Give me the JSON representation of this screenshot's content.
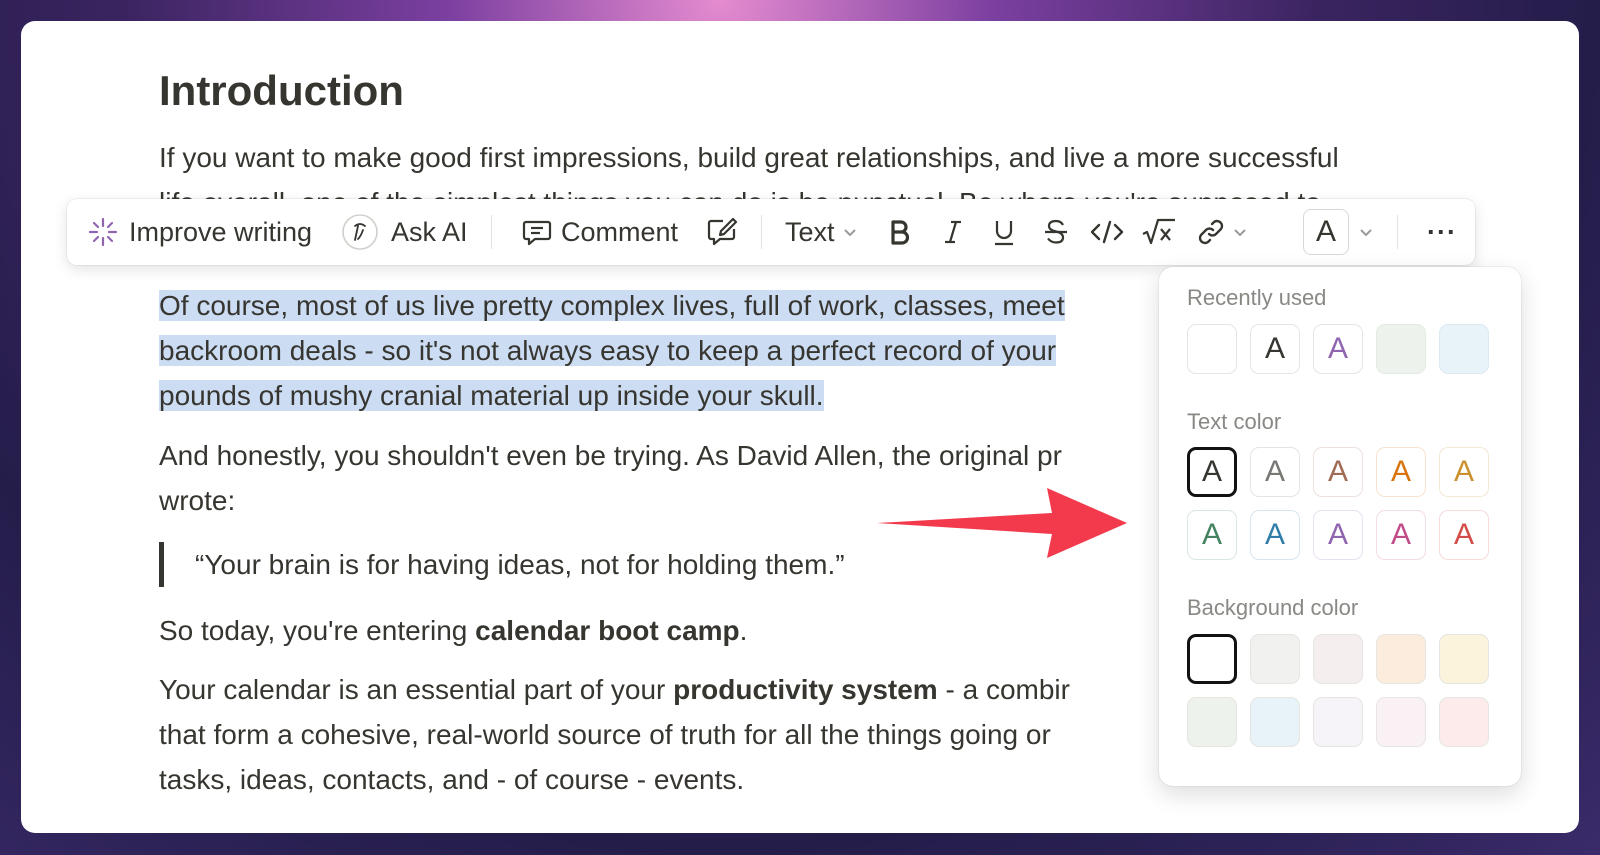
{
  "document": {
    "title": "Introduction",
    "paragraph1_line1": "If you want to make good first impressions, build great relationships, and live a more successful",
    "paragraph1_line2": "life overall, one of the simplest things you can do is be punctual. Be where you're supposed to",
    "paragraph2_line1": "Of course, most of us live pretty complex lives, full of work, classes, meet",
    "paragraph2_line2": "backroom deals - so it's not always easy to keep a perfect record of your",
    "paragraph2_line3": "pounds of mushy cranial material up inside your skull.",
    "paragraph3_line1": "And honestly, you shouldn't even be trying. As David Allen, the original pr",
    "paragraph3_line2": "wrote:",
    "quote": "“Your brain is for having ideas, not for holding them.”",
    "paragraph4_start": "So today, you're entering ",
    "paragraph4_bold": "calendar boot camp",
    "paragraph4_end": ".",
    "paragraph5_line1_start": "Your calendar is an essential part of your ",
    "paragraph5_line1_bold": "productivity system",
    "paragraph5_line1_end": " - a combir",
    "paragraph5_line2": "that form a cohesive, real-world source of truth for all the things going or",
    "paragraph5_line3": "tasks, ideas, contacts, and - of course - events."
  },
  "toolbar": {
    "improve_writing": "Improve writing",
    "ask_ai": "Ask AI",
    "comment": "Comment",
    "text_type": "Text",
    "color_button": "A",
    "more": "···"
  },
  "color_panel": {
    "recently_used_label": "Recently used",
    "text_color_label": "Text color",
    "background_color_label": "Background color",
    "glyph": "A",
    "recently_used": [
      {
        "bg": "#ffffff",
        "text": "",
        "border": "#e6e5e1"
      },
      {
        "bg": "#ffffff",
        "text": "#37352f",
        "border": "#e6e5e1"
      },
      {
        "bg": "#ffffff",
        "text": "#9065b0",
        "border": "#e6e5e1"
      },
      {
        "bg": "#edf3ec",
        "text": "",
        "border": "#e3ece2"
      },
      {
        "bg": "#e7f3f8",
        "text": "",
        "border": "#dcebf2"
      }
    ],
    "text_colors": [
      "#37352f",
      "#787774",
      "#9f6b53",
      "#d9730d",
      "#cb912f",
      "#448361",
      "#337ea9",
      "#9065b0",
      "#c14c8a",
      "#d44c47"
    ],
    "background_colors": [
      "#ffffff",
      "#f1f1ef",
      "#f4eeee",
      "#fbecdd",
      "#fbf3db",
      "#edf3ec",
      "#e7f3f8",
      "#f6f3f9",
      "#faf1f5",
      "#fdebec"
    ],
    "selected_text_color_index": 0,
    "selected_background_index": 0
  },
  "colors": {
    "selection_highlight": "#cbdcf3",
    "arrow": "#f23a4c",
    "ai_accent": "#9065b0"
  }
}
